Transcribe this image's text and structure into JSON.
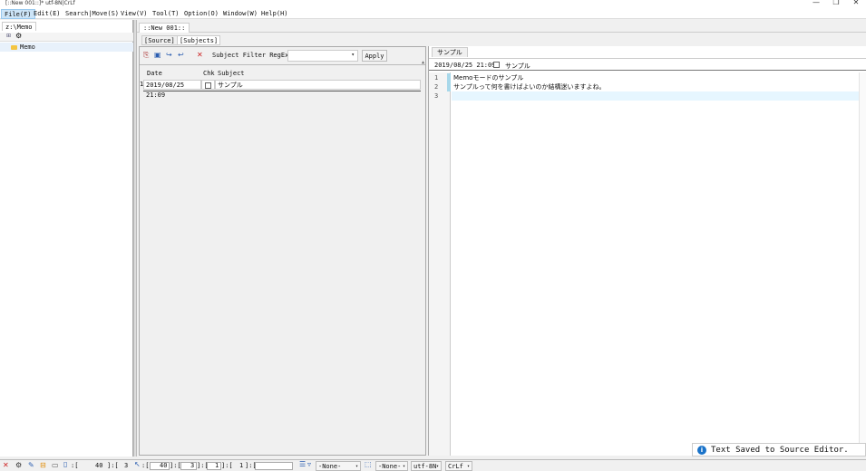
{
  "window": {
    "title": "[::New 001::]* utf-8N|CrLf",
    "min": "—",
    "max": "❐",
    "close": "✕"
  },
  "menu": [
    "File(F)",
    "Edit(E)",
    "Search|Move(S)",
    "View(V)",
    "Tool(T)",
    "Option(O)",
    "Window(W)",
    "Help(H)"
  ],
  "left_panel": {
    "tab": "z:\\Memo",
    "tree_item": "Memo"
  },
  "doc_tab": "::New 001::",
  "sub_tabs": [
    "[Source]",
    "[Subjects]"
  ],
  "subjects": {
    "filter_label": "Subject Filter RegEx:",
    "filter_value": "",
    "apply_label": "Apply",
    "columns": [
      "Date",
      "Chk",
      "Subject"
    ],
    "rows": [
      {
        "num": "1",
        "date": "2019/08/25 21:09",
        "subject": "サンプル"
      }
    ]
  },
  "editor": {
    "tab": "サンプル",
    "date": "2019/08/25 21:09",
    "subject": "サンプル",
    "line_numbers": [
      "1",
      "2",
      "3"
    ],
    "lines": [
      "Memoモードのサンプル",
      "サンプルって何を書けばよいのか結構迷いますよね。",
      ""
    ]
  },
  "toast": {
    "icon": "i",
    "message": "Text Saved to Source Editor."
  },
  "status": {
    "pos1": ":[",
    "val1": "40",
    "pos2": "]:[",
    "val2": "3",
    "pos3": ":[",
    "val3": "40",
    "pos4": "]:[",
    "val4": "3",
    "pos5": "]:[",
    "val5": "1",
    "pos6": "]:[",
    "val6": "1",
    "pos7": "]:[",
    "drop1": "-None-",
    "drop2": "-None-",
    "encoding": "utf-8N",
    "eol": "CrLf"
  }
}
